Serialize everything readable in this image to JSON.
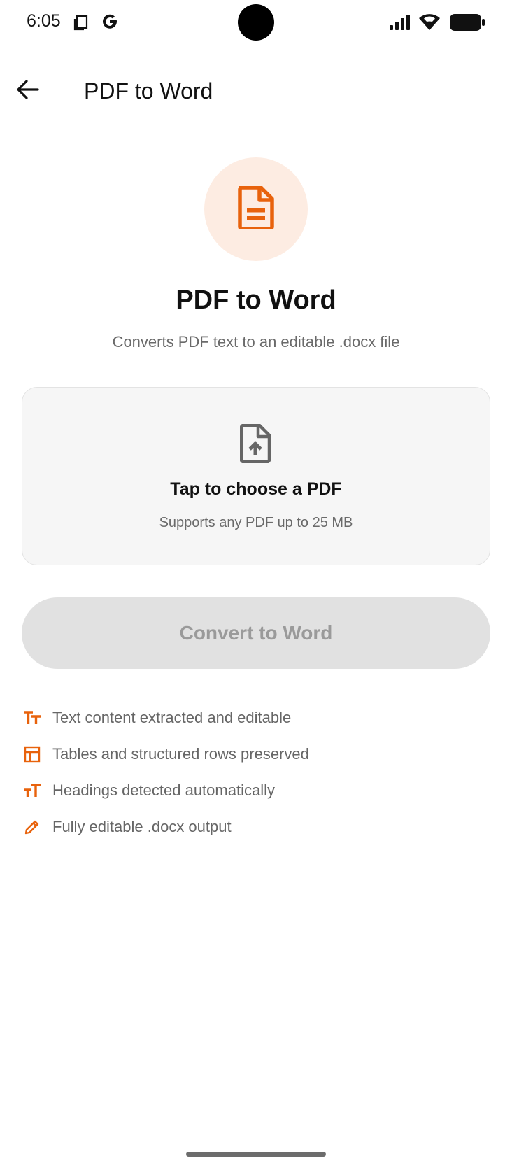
{
  "status_bar": {
    "time": "6:05",
    "icons": [
      "screenshot-icon",
      "google-icon",
      "signal-icon",
      "wifi-icon",
      "battery-icon"
    ]
  },
  "app_bar": {
    "back_icon": "arrow-left-icon",
    "title": "PDF to Word"
  },
  "hero": {
    "icon": "document-icon",
    "title": "PDF to Word",
    "subtitle": "Converts PDF text to an editable .docx file"
  },
  "file_picker": {
    "icon": "file-upload-icon",
    "title": "Tap to choose a PDF",
    "subtitle": "Supports any PDF up to 25 MB"
  },
  "convert_button": {
    "label": "Convert to Word",
    "state": "disabled"
  },
  "features": [
    {
      "icon": "text-format-icon",
      "label": "Text content extracted and editable"
    },
    {
      "icon": "table-icon",
      "label": "Tables and structured rows preserved"
    },
    {
      "icon": "heading-icon",
      "label": "Headings detected automatically"
    },
    {
      "icon": "pencil-icon",
      "label": "Fully editable .docx output"
    }
  ],
  "colors": {
    "accent": "#e8620c",
    "accent_bg": "#fdece2",
    "button_disabled_bg": "#e1e1e1",
    "button_disabled_text": "#9a9a9a",
    "muted_text": "#6a6a6a"
  }
}
